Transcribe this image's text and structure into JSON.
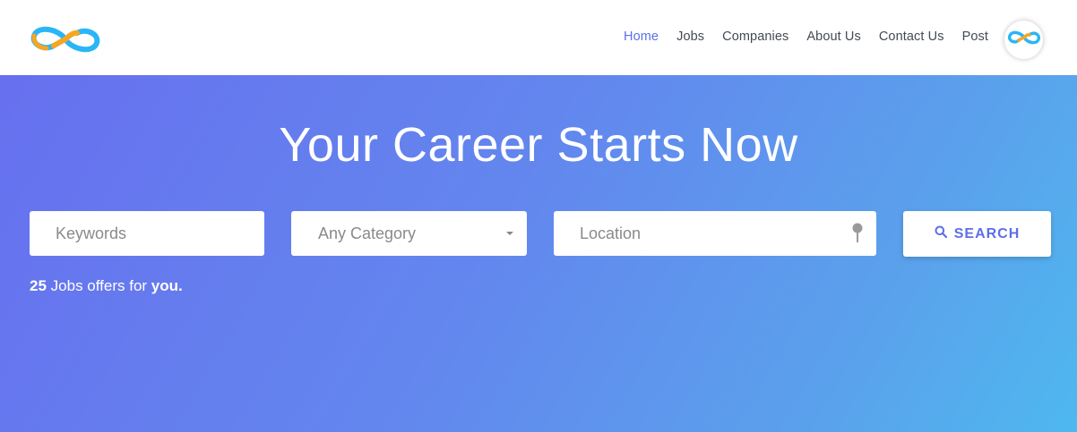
{
  "nav": {
    "logo_icon": "infinity-logo-icon",
    "links": [
      {
        "label": "Home",
        "active": true
      },
      {
        "label": "Jobs",
        "active": false
      },
      {
        "label": "Companies",
        "active": false
      },
      {
        "label": "About Us",
        "active": false
      },
      {
        "label": "Contact Us",
        "active": false
      },
      {
        "label": "Post",
        "active": false
      }
    ],
    "avatar_icon": "infinity-avatar-icon"
  },
  "hero": {
    "title": "Your Career Starts Now",
    "keywords_placeholder": "Keywords",
    "category_selected": "Any Category",
    "location_placeholder": "Location",
    "location_icon": "map-pin-icon",
    "search_label": "SEARCH",
    "search_icon": "magnifier-icon",
    "jobs_count": "25",
    "jobs_text": "Jobs offers for",
    "jobs_suffix": "you."
  },
  "colors": {
    "accent": "#5e6fe6",
    "gradient_start": "#6770ef",
    "gradient_end": "#4eb8ef",
    "logo_orange": "#f5a623",
    "logo_blue": "#29b6f6"
  }
}
